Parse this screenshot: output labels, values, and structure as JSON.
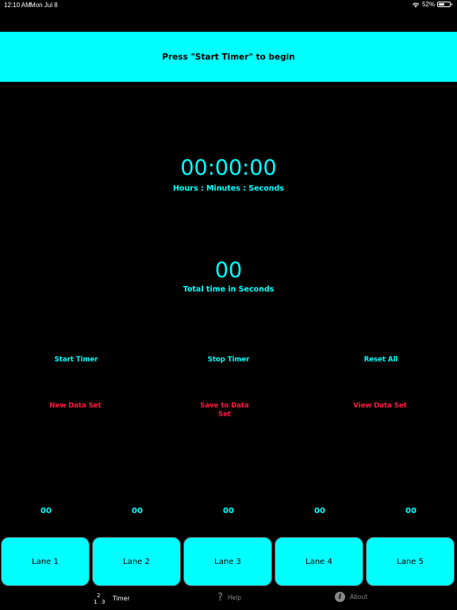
{
  "status_bar": {
    "time": "12:10 AM",
    "date": "Mon Jul 8",
    "battery": "52%",
    "battery_level": 0.52
  },
  "banner": {
    "message": "Press \"Start Timer\" to begin"
  },
  "timer": {
    "display": "00:00:00",
    "label": "Hours : Minutes : Seconds"
  },
  "total": {
    "display": "00",
    "label": "Total time in Seconds"
  },
  "controls": {
    "start": "Start Timer",
    "stop": "Stop Timer",
    "reset": "Reset All",
    "new_data_set": "New Data Set",
    "save_data_set": "Save to Data Set",
    "view_data_set": "View Data Set"
  },
  "lanes": [
    {
      "label": "Lane 1",
      "time": "00"
    },
    {
      "label": "Lane 2",
      "time": "00"
    },
    {
      "label": "Lane 3",
      "time": "00"
    },
    {
      "label": "Lane 4",
      "time": "00"
    },
    {
      "label": "Lane 5",
      "time": "00"
    }
  ],
  "tabs": {
    "timer": "Timer",
    "help": "Help",
    "about": "About",
    "timer_icon_digits": [
      "1",
      "2",
      "3"
    ],
    "help_icon_glyph": "?",
    "about_icon_glyph": "i"
  },
  "colors": {
    "accent": "#00ffff",
    "danger": "#ff1744",
    "background": "#000000"
  }
}
